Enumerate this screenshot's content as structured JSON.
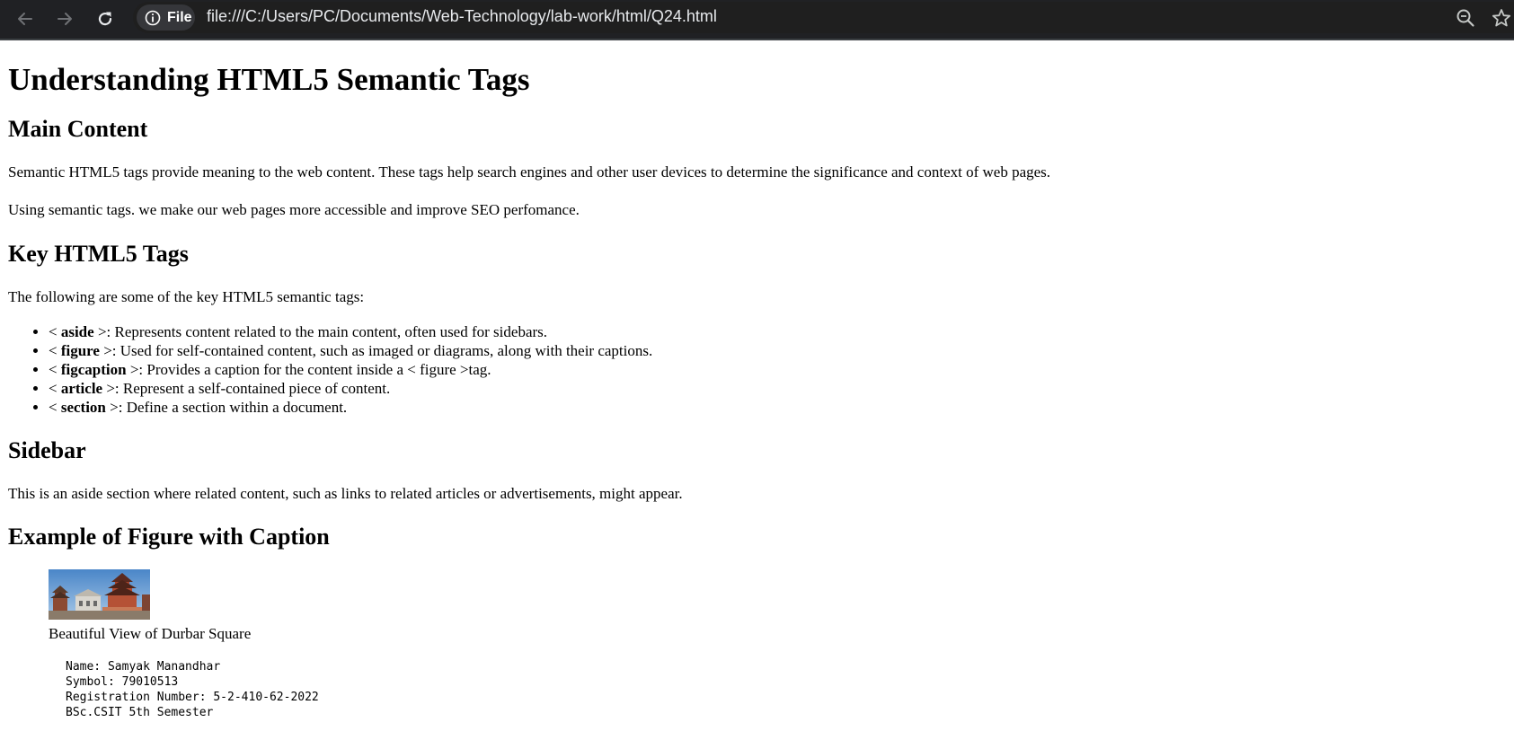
{
  "browser": {
    "url": "file:///C:/Users/PC/Documents/Web-Technology/lab-work/html/Q24.html",
    "chip_label": "File",
    "icons": [
      "back-arrow-icon",
      "forward-arrow-icon",
      "reload-icon",
      "info-icon",
      "zoom-icon",
      "star-icon"
    ]
  },
  "page": {
    "title": "Understanding HTML5 Semantic Tags",
    "main": {
      "heading": "Main Content",
      "paragraph1": "Semantic HTML5 tags provide meaning to the web content. These tags help search engines and other user devices to determine the significance and context of web pages.",
      "paragraph2": "Using semantic tags. we make our web pages more accessible and improve SEO perfomance."
    },
    "key_tags": {
      "heading": "Key HTML5 Tags",
      "intro": "The following are some of the key HTML5 semantic tags:",
      "items": [
        {
          "open": "< ",
          "tag": "aside",
          "desc": " >: Represents content related to the main content, often used for sidebars."
        },
        {
          "open": "< ",
          "tag": "figure",
          "desc": " >: Used for self-contained content, such as imaged or diagrams, along with their captions."
        },
        {
          "open": "< ",
          "tag": "figcaption",
          "desc": " >: Provides a caption for the content inside a < figure >tag."
        },
        {
          "open": "< ",
          "tag": "article",
          "desc": " >: Represent a self-contained piece of content."
        },
        {
          "open": "< ",
          "tag": "section",
          "desc": " >: Define a section within a document."
        }
      ]
    },
    "sidebar": {
      "heading": "Sidebar",
      "text": "This is an aside section where related content, such as links to related articles or advertisements, might appear."
    },
    "figure": {
      "heading": "Example of Figure with Caption",
      "caption": "Beautiful View of Durbar Square"
    },
    "info": {
      "name": "Name: Samyak Manandhar",
      "symbol": "Symbol: 79010513",
      "registration": "Registration Number: 5-2-410-62-2022",
      "program": "BSc.CSIT 5th Semester"
    }
  },
  "colors": {
    "toolbar_bg": "#202124",
    "omnibox_bg": "#1f1f1f",
    "chip_bg": "#35363a",
    "url_text": "#e8eaed"
  }
}
